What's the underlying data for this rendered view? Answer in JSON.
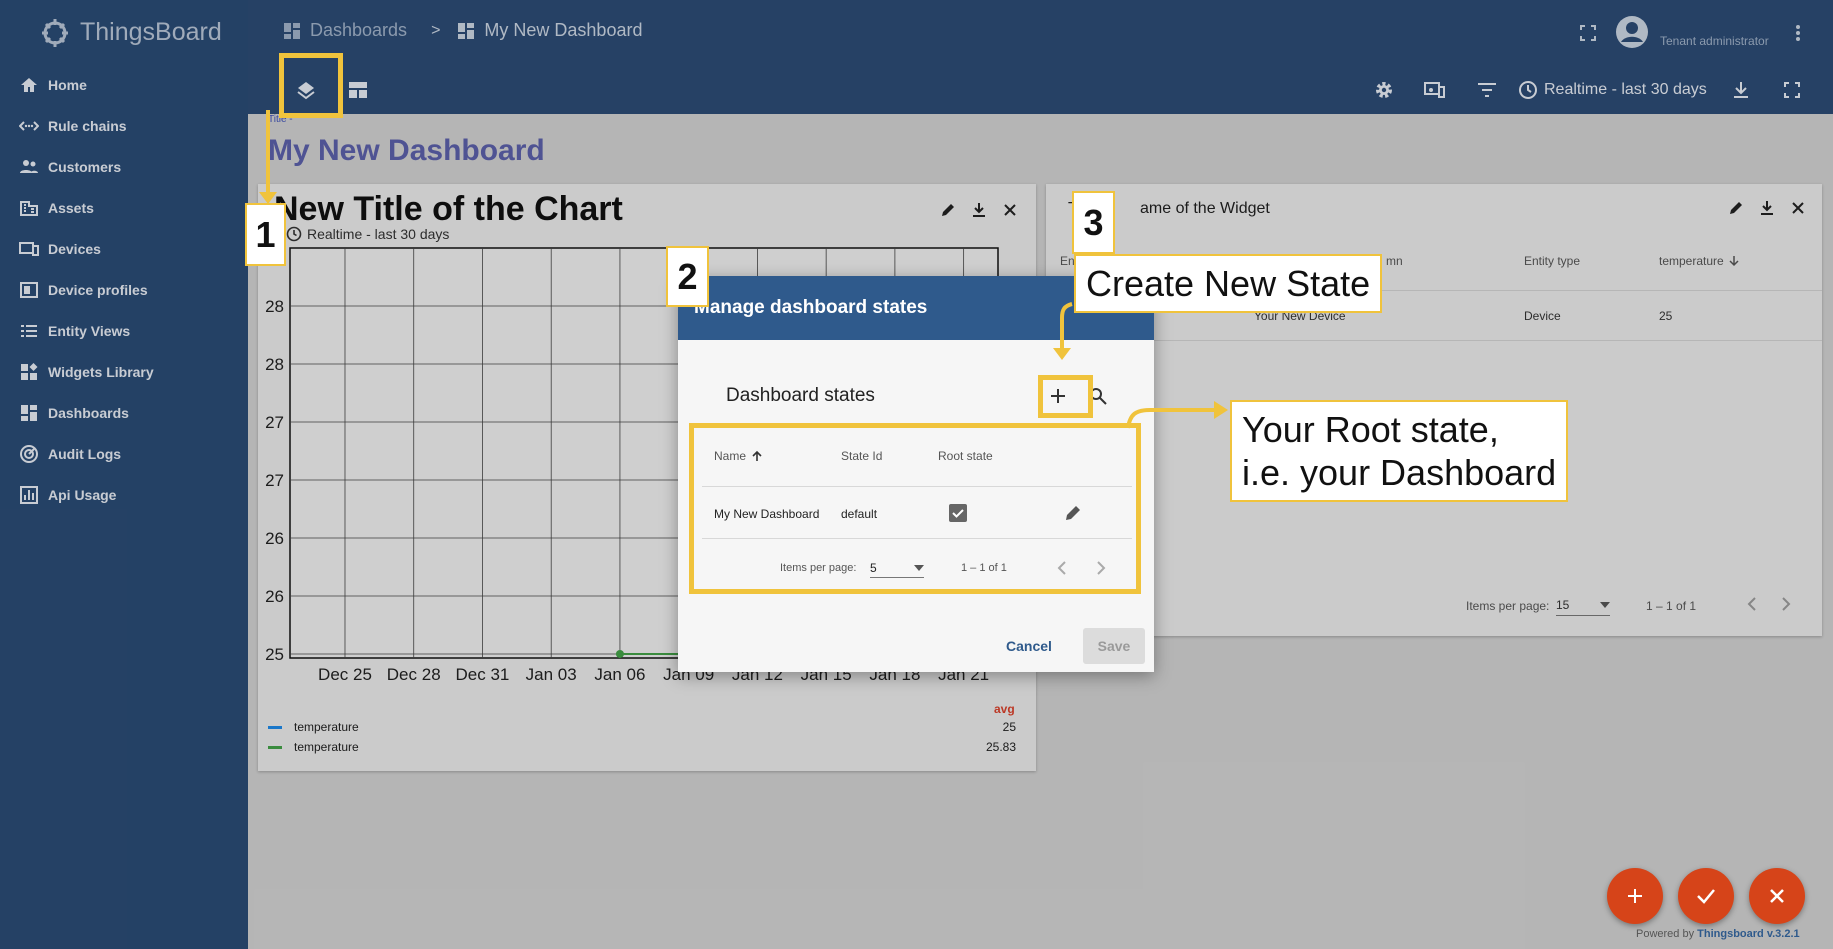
{
  "app": {
    "name": "ThingsBoard",
    "version_prefix": "Powered by",
    "version_link": "Thingsboard v.3.2.1"
  },
  "sidebar": {
    "items": [
      {
        "label": "Home",
        "icon": "home-icon"
      },
      {
        "label": "Rule chains",
        "icon": "rule-chain-icon"
      },
      {
        "label": "Customers",
        "icon": "customers-icon"
      },
      {
        "label": "Assets",
        "icon": "assets-icon"
      },
      {
        "label": "Devices",
        "icon": "devices-icon"
      },
      {
        "label": "Device profiles",
        "icon": "device-profiles-icon"
      },
      {
        "label": "Entity Views",
        "icon": "entity-views-icon"
      },
      {
        "label": "Widgets Library",
        "icon": "widgets-library-icon"
      },
      {
        "label": "Dashboards",
        "icon": "dashboards-icon"
      },
      {
        "label": "Audit Logs",
        "icon": "audit-logs-icon"
      },
      {
        "label": "Api Usage",
        "icon": "api-usage-icon"
      }
    ]
  },
  "topbar": {
    "breadcrumb": [
      "Dashboards",
      ">",
      "My New Dashboard"
    ],
    "user_role": "Tenant administrator",
    "timewindow": "Realtime - last 30 days"
  },
  "dashboard": {
    "title_small": "Title -",
    "title": "My New Dashboard"
  },
  "chart_widget": {
    "title": "New Title of the Chart",
    "timewindow": "Realtime - last 30 days",
    "legend_header": "avg",
    "legend": [
      {
        "name": "temperature",
        "value": "25",
        "color": "#1e88e5"
      },
      {
        "name": "temperature",
        "value": "25.83",
        "color": "#43a047"
      }
    ]
  },
  "chart_data": {
    "type": "line",
    "title": "New Title of the Chart",
    "x_ticks": [
      "Dec 25",
      "Dec 28",
      "Dec 31",
      "Jan 03",
      "Jan 06",
      "Jan 09",
      "Jan 12",
      "Jan 15",
      "Jan 18",
      "Jan 21"
    ],
    "y_ticks": [
      "28",
      "28",
      "27",
      "27",
      "26",
      "26",
      "25",
      "25"
    ],
    "y_top_partial": "28",
    "series": [
      {
        "name": "temperature",
        "color": "#43a047",
        "points": [
          {
            "x": "Jan 06",
            "y": 25
          },
          {
            "x": "Jan 09",
            "y": 25
          }
        ]
      }
    ],
    "grid": true
  },
  "table_widget": {
    "title_start": "T",
    "title_end": "ame of the Widget",
    "col1_partial": "En",
    "col2_partial": "mn",
    "columns": [
      "Entity type",
      "temperature"
    ],
    "row": {
      "name_partial": "e",
      "entity": "Your New Device",
      "type": "Device",
      "temperature": "25"
    },
    "items_per_page_label": "Items per page:",
    "items_per_page": "15",
    "range": "1 – 1 of 1"
  },
  "dialog": {
    "title": "Manage dashboard states",
    "section": "Dashboard states",
    "columns": {
      "name": "Name",
      "state_id": "State Id",
      "root": "Root state"
    },
    "rows": [
      {
        "name": "My New Dashboard",
        "state_id": "default",
        "root": true
      }
    ],
    "items_per_page_label": "Items per page:",
    "items_per_page": "5",
    "range": "1 – 1 of 1",
    "cancel": "Cancel",
    "save": "Save"
  },
  "annotations": {
    "badge1": "1",
    "badge2": "2",
    "badge3": "3",
    "callout_create": "Create New State",
    "callout_root_line1": "Your Root state,",
    "callout_root_line2": "i.e. your Dashboard"
  },
  "colors": {
    "sidebar": "#2a4a73",
    "accent": "#f0c33c",
    "fab": "#d64419",
    "dialog_header": "#2f5a8c",
    "title": "#3f51b5"
  }
}
